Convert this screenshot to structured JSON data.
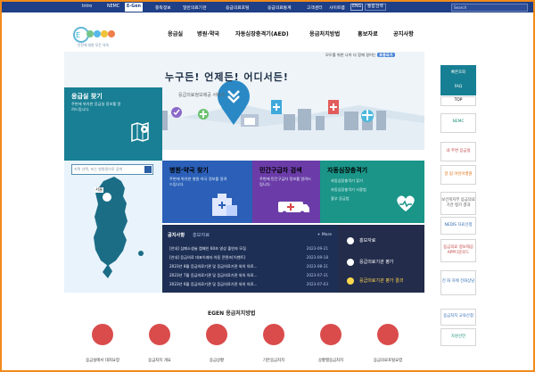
{
  "topbar": {
    "items": [
      "Intro",
      "NEMC",
      "E-Gen",
      "중독정보",
      "일반의료기관",
      "응급의료포털",
      "응급의료통계",
      "고객센터",
      "사이트맵"
    ],
    "eng": "ENG",
    "select": "통합검색",
    "search_placeholder": "Search"
  },
  "logo": {
    "name": "EGEN",
    "subtitle": "안전에 대한 모든 약속"
  },
  "nav": {
    "items": [
      "응급실",
      "병원·약국",
      "자동심장충격기(AED)",
      "응급처치방법",
      "홍보자료",
      "공지사항"
    ]
  },
  "hero": {
    "notice": "모두를 위한 나아 다 함께 걸어는",
    "notice_badge": "포용국가",
    "title": "누구든! 언제든! 어디서든!",
    "subtitle": "응급의료정보제공 서비스"
  },
  "aed": {
    "title": "응급실 찾기",
    "desc": "주변에 위치한 응급실 정보를 알려드립니다."
  },
  "map": {
    "search_placeholder": "지역 선택, 또는 병원명으로 검색",
    "region_label": "서울"
  },
  "cards": {
    "hospital": {
      "title": "병원·약국 찾기",
      "desc": "주변에 위치한 병원·약국 정보를 알려드립니다."
    },
    "ambulance": {
      "title": "민간구급차 검색",
      "desc": "주변에 민간구급차 정보를 알려드립니다."
    },
    "aed_card": {
      "title": "자동심장충격기",
      "bullets": [
        "자동심장충격기 찾기",
        "자동심장충격기 사용법",
        "흉부 응급법"
      ]
    }
  },
  "board": {
    "tab1": "공지사항",
    "tab2": "홍보자료",
    "more": "+ More",
    "rows": [
      {
        "title": "[안내] 심폐소생술 캠페인 60초 영상 출연자 모집",
        "date": "2023-09-21"
      },
      {
        "title": "[안내] 응급의료 대표이래자 아동 콘텐츠[이벤트]",
        "date": "2023-09-18"
      },
      {
        "title": "2023년 8월 응급의료기관 및 응급의료기관 외의 의료...",
        "date": "2023-08-31"
      },
      {
        "title": "2023년 7월 응급의료기관 및 응급의료기관 외의 의료...",
        "date": "2023-07-31"
      },
      {
        "title": "2023년 6월 응급의료기관 및 응급의료기관 외의 의료...",
        "date": "2023-07-03"
      }
    ]
  },
  "promo": {
    "items": [
      "홍보자료",
      "응급의료기관 평가",
      "응급의료기관 평가 결과"
    ]
  },
  "emergency": {
    "title": "EGEN 응급처치방법",
    "items": [
      "응급실에서 대처요령",
      "응급처치 개요",
      "응급상황",
      "기본응급처치",
      "상황별응급처치",
      "응급의료포털요령"
    ]
  },
  "side": {
    "items": [
      "빠른조회",
      "FAQ",
      "TOP",
      "NEMC",
      "내 주변 응급실",
      "알 림 어린이병원",
      "보건복지부 응급의료기관 평가 결과",
      "NEDIS 자료신청",
      "응급의료 정보제공 APP다운로드",
      "전 화 자체 전화상담",
      "응급처치 교육신청",
      "자원선언"
    ]
  },
  "colors": {
    "frame": "#f08a1c",
    "topbar": "#1f3f86",
    "teal": "#187f94",
    "blue": "#2b5fb8",
    "purple": "#6b3ca8",
    "green": "#1a9588",
    "navy": "#1e2f55"
  }
}
